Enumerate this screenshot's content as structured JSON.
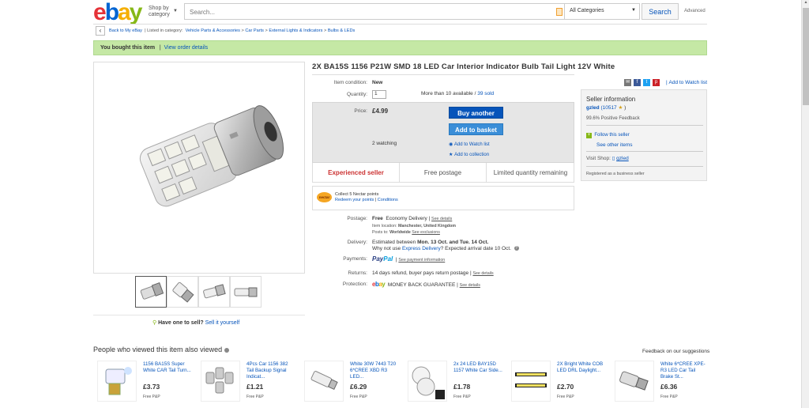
{
  "header": {
    "logo": [
      "e",
      "b",
      "a",
      "y"
    ],
    "shop_by": "Shop by category",
    "shop_by_line1": "Shop by",
    "shop_by_line2": "category",
    "search_placeholder": "Search...",
    "category": "All Categories",
    "search_button": "Search",
    "advanced": "Advanced"
  },
  "breadcrumb": {
    "back": "Back to My eBay",
    "listed_in": "Listed in category:",
    "items": [
      "Vehicle Parts & Accessories",
      "Car Parts",
      "External Lights & Indicators",
      "Bulbs & LEDs"
    ]
  },
  "banner": {
    "text": "You bought this item",
    "link": "View order details"
  },
  "item": {
    "title": "2X BA15S 1156 P21W SMD 18 LED Car Interior Indicator Bulb Tail Light 12V White",
    "condition_label": "Item condition:",
    "condition": "New",
    "quantity_label": "Quantity:",
    "quantity": "1",
    "available": "More than 10 available /",
    "sold": "39 sold",
    "price_label": "Price:",
    "price": "£4.99",
    "buy_another": "Buy another",
    "add_to_basket": "Add to basket",
    "watching": "2 watching",
    "add_to_watch": "Add to Watch list",
    "add_to_collection": "Add to collection",
    "badges": [
      "Experienced seller",
      "Free postage",
      "Limited quantity remaining"
    ],
    "nectar_line1": "Collect 5 Nectar points",
    "nectar_line2a": "Redeem your points",
    "nectar_line2b": "Conditions",
    "nectar_logo": "nectar",
    "have_one": "Have one to sell?",
    "sell_it": "Sell it yourself"
  },
  "postage": {
    "label": "Postage:",
    "free": "Free",
    "service": "Economy Delivery |",
    "see_details": "See details",
    "location_label": "Item location:",
    "location": "Manchester, United Kingdom",
    "posts_label": "Posts to:",
    "posts": "Worldwide",
    "exclusions": "See exclusions"
  },
  "delivery": {
    "label": "Delivery:",
    "estimated": "Estimated between",
    "dates": "Mon. 13 Oct. and Tue. 14 Oct.",
    "why_not": "Why not use",
    "express": "Express Delivery",
    "arrival": "? Expected arrival date 10 Oct."
  },
  "payments": {
    "label": "Payments:",
    "paypal_a": "Pay",
    "paypal_b": "Pal",
    "details": "See payment information"
  },
  "returns": {
    "label": "Returns:",
    "text": "14 days refund, buyer pays return postage |",
    "details": "See details"
  },
  "protection": {
    "label": "Protection:",
    "text": "MONEY BACK GUARANTEE",
    "details": "See details"
  },
  "watch_list": "Add to Watch list",
  "seller": {
    "heading": "Seller information",
    "name": "gzled",
    "score": "(10517",
    "feedback": "99.6% Positive Feedback",
    "follow": "Follow this seller",
    "other_items": "See other items",
    "visit_shop": "Visit Shop:",
    "shop_name": "gzled",
    "registered": "Registered as a business seller"
  },
  "also_viewed": {
    "heading": "People who viewed this item also viewed",
    "feedback": "Feedback on our suggestions",
    "items": [
      {
        "title": "1156 BA15S Super White CAR Tail Turn...",
        "price": "£3.73",
        "postage": "Free P&P"
      },
      {
        "title": "4Pcs Car 1156 382 Tail Backup Signal Indicat...",
        "price": "£1.21",
        "postage": "Free P&P"
      },
      {
        "title": "White 30W 7443 T20 6*CREE XBD R3 LED...",
        "price": "£6.29",
        "postage": "Free P&P"
      },
      {
        "title": "2x 24 LED BAY15D 1157 White Car Side...",
        "price": "£1.78",
        "postage": "Free P&P"
      },
      {
        "title": "2X Bright White COB LED DRL Daylight...",
        "price": "£2.70",
        "postage": "Free P&P"
      },
      {
        "title": "White 6*CREE XPE-R3 LED Car Tail Brake St...",
        "price": "£6.36",
        "postage": "Free P&P"
      }
    ]
  },
  "colors": {
    "link": "#0654ba",
    "banner": "#c5e8a5",
    "button": "#0654ba",
    "experienced": "#cc3333"
  }
}
